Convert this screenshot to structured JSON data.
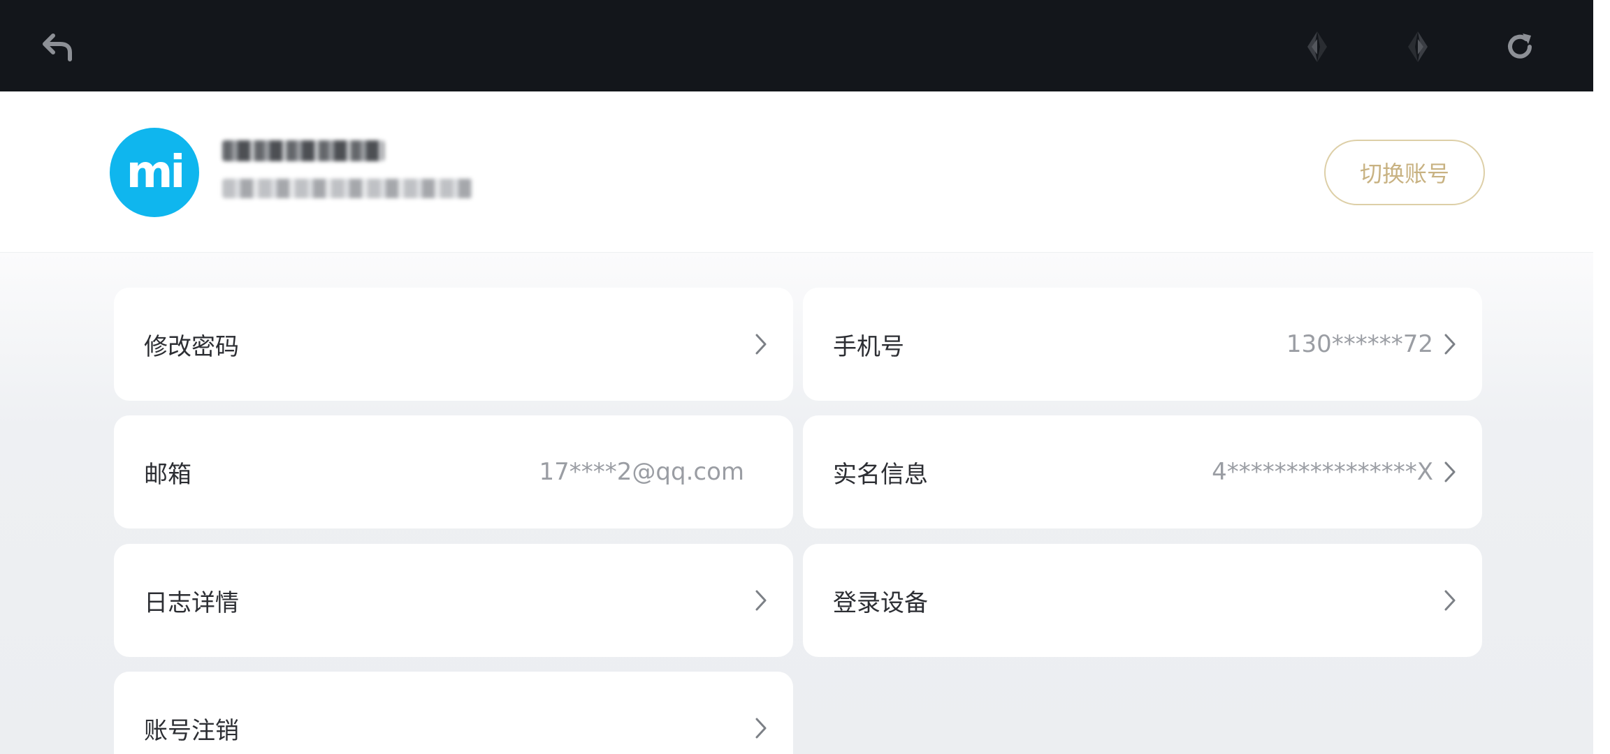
{
  "toolbar": {
    "back_icon": "back-arrow-icon",
    "prev_icon": "prev-diamond-icon",
    "next_icon": "next-diamond-icon",
    "refresh_icon": "refresh-icon"
  },
  "account": {
    "avatar_text": "mi",
    "switch_label": "切换账号"
  },
  "settings": [
    {
      "label": "修改密码",
      "value": "",
      "chevron": true
    },
    {
      "label": "手机号",
      "value": "130******72",
      "chevron": true
    },
    {
      "label": "邮箱",
      "value": "17****2@qq.com",
      "chevron": false
    },
    {
      "label": "实名信息",
      "value": "4****************X",
      "chevron": true
    },
    {
      "label": "日志详情",
      "value": "",
      "chevron": true
    },
    {
      "label": "登录设备",
      "value": "",
      "chevron": true
    },
    {
      "label": "账号注销",
      "value": "",
      "chevron": true
    }
  ],
  "colors": {
    "topbar": "#13161b",
    "avatar": "#0fb6ee",
    "accent_gold": "#c8b282"
  }
}
